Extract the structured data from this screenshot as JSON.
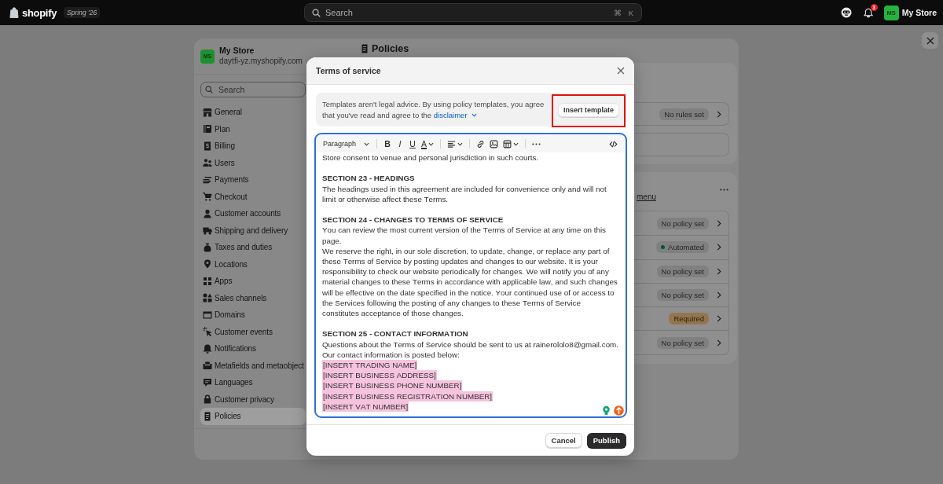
{
  "top_bar": {
    "logo": "shopify",
    "edition": "Spring '26",
    "search": {
      "placeholder": "Search",
      "shortcut": [
        "⌘",
        "K"
      ]
    },
    "notification_count": "3",
    "account": {
      "initials": "MS",
      "name": "My Store"
    }
  },
  "settings": {
    "store": {
      "initials": "MS",
      "name": "My Store",
      "domain": "daytfi-yz.myshopify.com"
    },
    "search": {
      "placeholder": "Search"
    },
    "sidebar": {
      "items": [
        {
          "label": "General",
          "selected": false
        },
        {
          "label": "Plan",
          "selected": false
        },
        {
          "label": "Billing",
          "selected": false
        },
        {
          "label": "Users",
          "selected": false
        },
        {
          "label": "Payments",
          "selected": false
        },
        {
          "label": "Checkout",
          "selected": false
        },
        {
          "label": "Customer accounts",
          "selected": false
        },
        {
          "label": "Shipping and delivery",
          "selected": false
        },
        {
          "label": "Taxes and duties",
          "selected": false
        },
        {
          "label": "Locations",
          "selected": false
        },
        {
          "label": "Apps",
          "selected": false
        },
        {
          "label": "Sales channels",
          "selected": false
        },
        {
          "label": "Domains",
          "selected": false
        },
        {
          "label": "Customer events",
          "selected": false
        },
        {
          "label": "Notifications",
          "selected": false
        },
        {
          "label": "Metafields and metaobject",
          "selected": false
        },
        {
          "label": "Languages",
          "selected": false
        },
        {
          "label": "Customer privacy",
          "selected": false
        },
        {
          "label": "Policies",
          "selected": true
        }
      ]
    },
    "page_title": "Policies",
    "cards": [
      {
        "kind": "separate",
        "actions_menu": false,
        "rows": [
          {
            "kind": "neutral",
            "badge": "No rules set"
          },
          {
            "kind": "empty"
          }
        ]
      },
      {
        "kind": "grouped",
        "link": "menu",
        "actions_menu": true,
        "rows": [
          {
            "kind": "neutral",
            "badge": "No policy set"
          },
          {
            "kind": "success",
            "badge": "Automated"
          },
          {
            "kind": "neutral",
            "badge": "No policy set"
          },
          {
            "kind": "neutral",
            "badge": "No policy set"
          },
          {
            "kind": "attention",
            "badge": "Required"
          },
          {
            "kind": "neutral",
            "badge": "No policy set"
          }
        ]
      }
    ]
  },
  "dialog": {
    "title": "Terms of service",
    "notice": {
      "text": "Templates aren't legal advice. By using policy templates, you agree that you've read and agree to the",
      "link": "disclaimer",
      "button": {
        "label": "Insert template",
        "highlighted": true
      }
    },
    "editor": {
      "toolbar": {
        "groups": [
          [
            {
              "kind": "block-format",
              "label": "Paragraph"
            }
          ],
          [
            {
              "kind": "bold",
              "label": "B"
            },
            {
              "kind": "italic",
              "label": "I"
            },
            {
              "kind": "underline",
              "label": "U"
            },
            {
              "kind": "text-color",
              "label": "A"
            }
          ],
          [
            {
              "kind": "align"
            }
          ],
          [
            {
              "kind": "link"
            },
            {
              "kind": "image"
            },
            {
              "kind": "table"
            }
          ],
          [
            {
              "kind": "more"
            }
          ]
        ],
        "end": [
          {
            "kind": "code"
          }
        ]
      },
      "blocks": [
        {
          "kind": "text",
          "text": "Store consent to venue and personal jurisdiction in such courts."
        },
        {
          "kind": "heading",
          "text": "SECTION 23 - HEADINGS"
        },
        {
          "kind": "text",
          "text": "The headings used in this agreement are included for convenience only and will not limit or otherwise affect these Terms."
        },
        {
          "kind": "heading",
          "text": "SECTION 24 - CHANGES TO TERMS OF SERVICE"
        },
        {
          "kind": "text",
          "text": "You can review the most current version of the Terms of Service at any time on this page."
        },
        {
          "kind": "text",
          "text": "We reserve the right, in our sole discretion, to update, change, or replace any part of these Terms of Service by posting updates and changes to our website. It is your responsibility to check our website periodically for changes. We will notify you of any material changes to these Terms in accordance with applicable law, and such changes will be effective on the date specified in the notice. Your continued use of or access to the Services following the posting of any changes to these Terms of Service constitutes acceptance of those changes."
        },
        {
          "kind": "heading",
          "text": "SECTION 25 - CONTACT INFORMATION"
        },
        {
          "kind": "text",
          "text": "Questions about the Terms of Service should be sent to us at rainerololo8@gmail.com. Our contact information is posted below:"
        },
        {
          "kind": "highlighted",
          "text": "[INSERT TRADING NAME]"
        },
        {
          "kind": "highlighted",
          "text": "[INSERT BUSINESS ADDRESS]"
        },
        {
          "kind": "highlighted",
          "text": "[INSERT BUSINESS PHONE NUMBER]"
        },
        {
          "kind": "highlighted",
          "text": "[INSERT BUSINESS REGISTRATION NUMBER]"
        },
        {
          "kind": "highlighted",
          "text": "[INSERT VAT NUMBER]"
        }
      ]
    },
    "buttons": [
      {
        "label": "Cancel",
        "kind": "secondary"
      },
      {
        "label": "Publish",
        "kind": "primary"
      }
    ]
  }
}
